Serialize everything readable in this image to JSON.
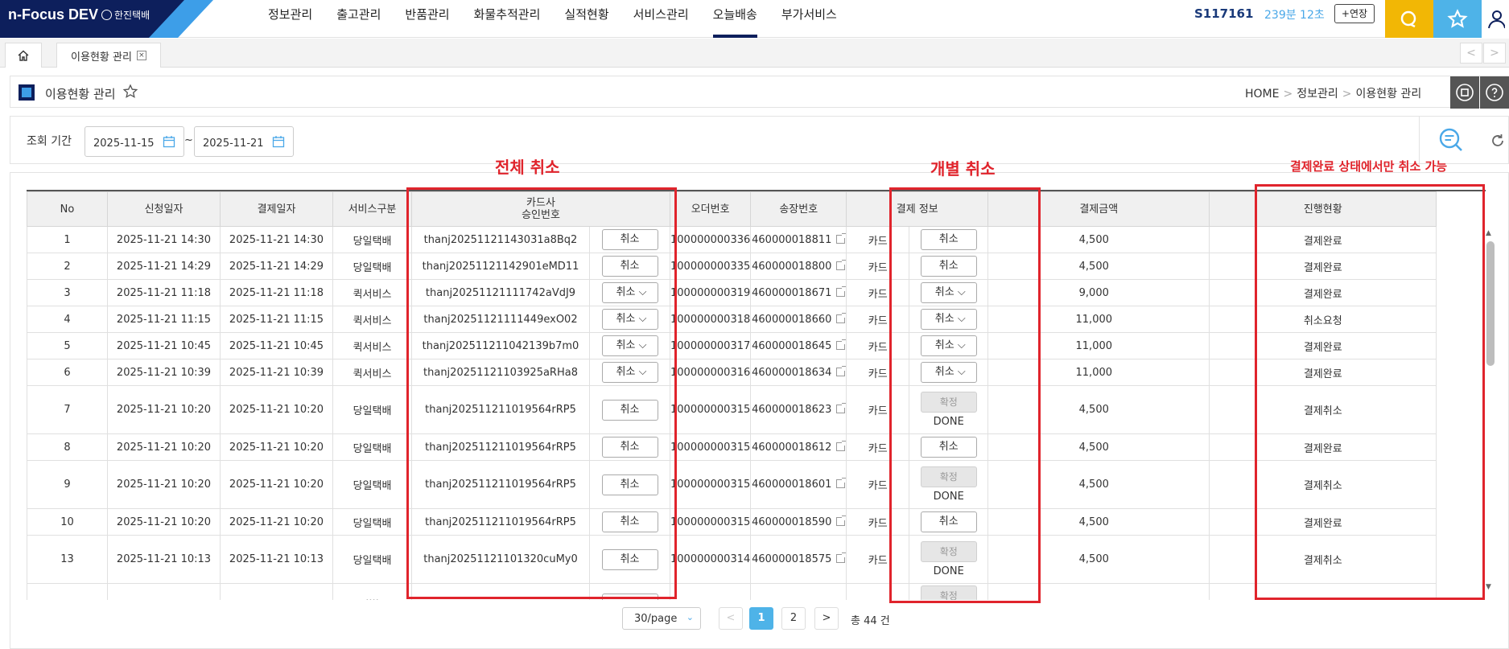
{
  "header": {
    "logo": "n-Focus DEV",
    "logo_sub": "한진택배",
    "menu": [
      "정보관리",
      "출고관리",
      "반품관리",
      "화물추적관리",
      "실적현황",
      "서비스관리",
      "오늘배송",
      "부가서비스"
    ],
    "active_menu": "오늘배송",
    "user_id": "S117161",
    "timer": "239분 12초",
    "extend_label": "+연장"
  },
  "tabs": {
    "page_tab": "이용현황 관리",
    "close": "×",
    "prev": "<",
    "next": ">"
  },
  "titlebar": {
    "title": "이용현황 관리",
    "breadcrumb": [
      "HOME",
      "정보관리",
      "이용현황 관리"
    ],
    "sep": ">"
  },
  "search": {
    "label": "조회 기간",
    "date_from": "2025-11-15",
    "date_to": "2025-11-21",
    "tilde": "~"
  },
  "grid": {
    "columns": [
      "No",
      "신청일자",
      "결제일자",
      "서비스구분",
      "카드사\n승인번호",
      "오더번호",
      "송장번호",
      "결제 정보",
      "결제금액",
      "진행현황"
    ],
    "cancel_label": "취소",
    "confirm_label": "확정",
    "done_label": "DONE",
    "rows": [
      {
        "no": "1",
        "req": "2025-11-21 14:30",
        "pay": "2025-11-21 14:30",
        "svc": "당일택배",
        "appr": "thanj20251121143031a8Bq2",
        "order": "100000000336",
        "invoice": "460000018811",
        "method": "카드",
        "amount": "4,500",
        "status": "결제완료"
      },
      {
        "no": "2",
        "req": "2025-11-21 14:29",
        "pay": "2025-11-21 14:29",
        "svc": "당일택배",
        "appr": "thanj20251121142901eMD11",
        "order": "100000000335",
        "invoice": "460000018800",
        "method": "카드",
        "amount": "4,500",
        "status": "결제완료"
      },
      {
        "no": "3",
        "req": "2025-11-21 11:18",
        "pay": "2025-11-21 11:18",
        "svc": "퀵서비스",
        "appr": "thanj20251121111742aVdJ9",
        "order": "100000000319",
        "invoice": "460000018671",
        "method": "카드",
        "amount": "9,000",
        "status": "결제완료"
      },
      {
        "no": "4",
        "req": "2025-11-21 11:15",
        "pay": "2025-11-21 11:15",
        "svc": "퀵서비스",
        "appr": "thanj20251121111449exO02",
        "order": "100000000318",
        "invoice": "460000018660",
        "method": "카드",
        "amount": "11,000",
        "status": "취소요청"
      },
      {
        "no": "5",
        "req": "2025-11-21 10:45",
        "pay": "2025-11-21 10:45",
        "svc": "퀵서비스",
        "appr": "thanj202511211042139b7m0",
        "order": "100000000317",
        "invoice": "460000018645",
        "method": "카드",
        "amount": "11,000",
        "status": "결제완료"
      },
      {
        "no": "6",
        "req": "2025-11-21 10:39",
        "pay": "2025-11-21 10:39",
        "svc": "퀵서비스",
        "appr": "thanj20251121103925aRHa8",
        "order": "100000000316",
        "invoice": "460000018634",
        "method": "카드",
        "amount": "11,000",
        "status": "결제완료"
      },
      {
        "no": "7",
        "req": "2025-11-21 10:20",
        "pay": "2025-11-21 10:20",
        "svc": "당일택배",
        "appr": "thanj20251121101956​4rRP5",
        "order": "100000000315",
        "invoice": "460000018623",
        "method": "카드",
        "amount": "4,500",
        "status": "결제취소"
      },
      {
        "no": "8",
        "req": "2025-11-21 10:20",
        "pay": "2025-11-21 10:20",
        "svc": "당일택배",
        "appr": "thanj202511211019564rRP5",
        "order": "100000000315",
        "invoice": "460000018612",
        "method": "카드",
        "amount": "4,500",
        "status": "결제완료"
      },
      {
        "no": "9",
        "req": "2025-11-21 10:20",
        "pay": "2025-11-21 10:20",
        "svc": "당일택배",
        "appr": "thanj202511211019564rRP5",
        "order": "100000000315",
        "invoice": "460000018601",
        "method": "카드",
        "amount": "4,500",
        "status": "결제취소"
      },
      {
        "no": "10",
        "req": "2025-11-21 10:20",
        "pay": "2025-11-21 10:20",
        "svc": "당일택배",
        "appr": "thanj202511211019564rRP5",
        "order": "100000000315",
        "invoice": "460000018590",
        "method": "카드",
        "amount": "4,500",
        "status": "결제완료"
      },
      {
        "no": "13",
        "req": "2025-11-21 10:13",
        "pay": "2025-11-21 10:13",
        "svc": "당일택배",
        "appr": "thanj20251121101320cuMy0",
        "order": "100000000314",
        "invoice": "460000018575",
        "method": "카드",
        "amount": "4,500",
        "status": "결제취소"
      }
    ],
    "partial_svc": "····"
  },
  "pagination": {
    "per_page": "30/page",
    "pages": [
      "1",
      "2"
    ],
    "current": "1",
    "total": "총 44 건",
    "prev": "<",
    "next": ">"
  },
  "annotations": {
    "all_cancel": "전체 취소",
    "item_cancel": "개별 취소",
    "note": "결제완료 상태에서만 취소 가능",
    "color": "#e0242c"
  },
  "colors": {
    "navy": "#0d1f5c",
    "sky": "#4eb3e8",
    "yellow": "#f2b705"
  }
}
